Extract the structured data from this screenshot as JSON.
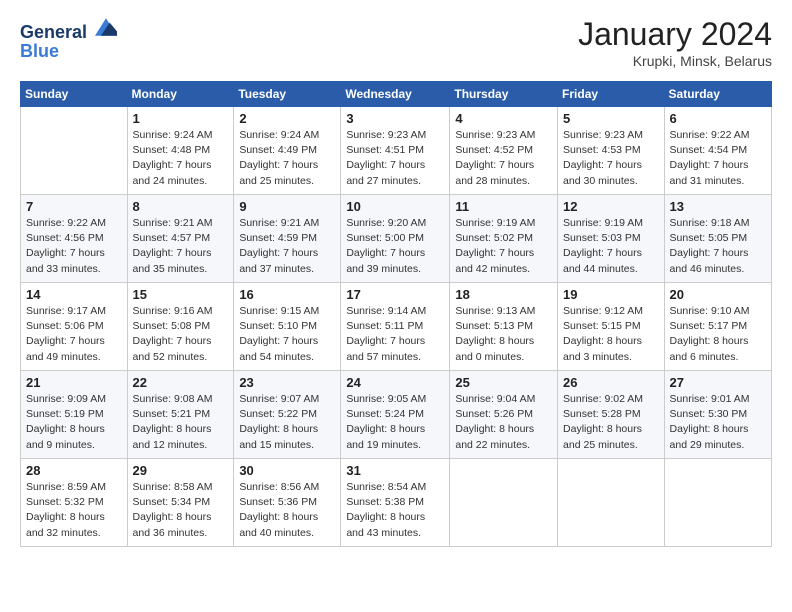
{
  "header": {
    "logo_line1": "General",
    "logo_line2": "Blue",
    "month_title": "January 2024",
    "location": "Krupki, Minsk, Belarus"
  },
  "calendar": {
    "weekdays": [
      "Sunday",
      "Monday",
      "Tuesday",
      "Wednesday",
      "Thursday",
      "Friday",
      "Saturday"
    ],
    "weeks": [
      [
        {
          "date": "",
          "info": ""
        },
        {
          "date": "1",
          "info": "Sunrise: 9:24 AM\nSunset: 4:48 PM\nDaylight: 7 hours\nand 24 minutes."
        },
        {
          "date": "2",
          "info": "Sunrise: 9:24 AM\nSunset: 4:49 PM\nDaylight: 7 hours\nand 25 minutes."
        },
        {
          "date": "3",
          "info": "Sunrise: 9:23 AM\nSunset: 4:51 PM\nDaylight: 7 hours\nand 27 minutes."
        },
        {
          "date": "4",
          "info": "Sunrise: 9:23 AM\nSunset: 4:52 PM\nDaylight: 7 hours\nand 28 minutes."
        },
        {
          "date": "5",
          "info": "Sunrise: 9:23 AM\nSunset: 4:53 PM\nDaylight: 7 hours\nand 30 minutes."
        },
        {
          "date": "6",
          "info": "Sunrise: 9:22 AM\nSunset: 4:54 PM\nDaylight: 7 hours\nand 31 minutes."
        }
      ],
      [
        {
          "date": "7",
          "info": "Sunrise: 9:22 AM\nSunset: 4:56 PM\nDaylight: 7 hours\nand 33 minutes."
        },
        {
          "date": "8",
          "info": "Sunrise: 9:21 AM\nSunset: 4:57 PM\nDaylight: 7 hours\nand 35 minutes."
        },
        {
          "date": "9",
          "info": "Sunrise: 9:21 AM\nSunset: 4:59 PM\nDaylight: 7 hours\nand 37 minutes."
        },
        {
          "date": "10",
          "info": "Sunrise: 9:20 AM\nSunset: 5:00 PM\nDaylight: 7 hours\nand 39 minutes."
        },
        {
          "date": "11",
          "info": "Sunrise: 9:19 AM\nSunset: 5:02 PM\nDaylight: 7 hours\nand 42 minutes."
        },
        {
          "date": "12",
          "info": "Sunrise: 9:19 AM\nSunset: 5:03 PM\nDaylight: 7 hours\nand 44 minutes."
        },
        {
          "date": "13",
          "info": "Sunrise: 9:18 AM\nSunset: 5:05 PM\nDaylight: 7 hours\nand 46 minutes."
        }
      ],
      [
        {
          "date": "14",
          "info": "Sunrise: 9:17 AM\nSunset: 5:06 PM\nDaylight: 7 hours\nand 49 minutes."
        },
        {
          "date": "15",
          "info": "Sunrise: 9:16 AM\nSunset: 5:08 PM\nDaylight: 7 hours\nand 52 minutes."
        },
        {
          "date": "16",
          "info": "Sunrise: 9:15 AM\nSunset: 5:10 PM\nDaylight: 7 hours\nand 54 minutes."
        },
        {
          "date": "17",
          "info": "Sunrise: 9:14 AM\nSunset: 5:11 PM\nDaylight: 7 hours\nand 57 minutes."
        },
        {
          "date": "18",
          "info": "Sunrise: 9:13 AM\nSunset: 5:13 PM\nDaylight: 8 hours\nand 0 minutes."
        },
        {
          "date": "19",
          "info": "Sunrise: 9:12 AM\nSunset: 5:15 PM\nDaylight: 8 hours\nand 3 minutes."
        },
        {
          "date": "20",
          "info": "Sunrise: 9:10 AM\nSunset: 5:17 PM\nDaylight: 8 hours\nand 6 minutes."
        }
      ],
      [
        {
          "date": "21",
          "info": "Sunrise: 9:09 AM\nSunset: 5:19 PM\nDaylight: 8 hours\nand 9 minutes."
        },
        {
          "date": "22",
          "info": "Sunrise: 9:08 AM\nSunset: 5:21 PM\nDaylight: 8 hours\nand 12 minutes."
        },
        {
          "date": "23",
          "info": "Sunrise: 9:07 AM\nSunset: 5:22 PM\nDaylight: 8 hours\nand 15 minutes."
        },
        {
          "date": "24",
          "info": "Sunrise: 9:05 AM\nSunset: 5:24 PM\nDaylight: 8 hours\nand 19 minutes."
        },
        {
          "date": "25",
          "info": "Sunrise: 9:04 AM\nSunset: 5:26 PM\nDaylight: 8 hours\nand 22 minutes."
        },
        {
          "date": "26",
          "info": "Sunrise: 9:02 AM\nSunset: 5:28 PM\nDaylight: 8 hours\nand 25 minutes."
        },
        {
          "date": "27",
          "info": "Sunrise: 9:01 AM\nSunset: 5:30 PM\nDaylight: 8 hours\nand 29 minutes."
        }
      ],
      [
        {
          "date": "28",
          "info": "Sunrise: 8:59 AM\nSunset: 5:32 PM\nDaylight: 8 hours\nand 32 minutes."
        },
        {
          "date": "29",
          "info": "Sunrise: 8:58 AM\nSunset: 5:34 PM\nDaylight: 8 hours\nand 36 minutes."
        },
        {
          "date": "30",
          "info": "Sunrise: 8:56 AM\nSunset: 5:36 PM\nDaylight: 8 hours\nand 40 minutes."
        },
        {
          "date": "31",
          "info": "Sunrise: 8:54 AM\nSunset: 5:38 PM\nDaylight: 8 hours\nand 43 minutes."
        },
        {
          "date": "",
          "info": ""
        },
        {
          "date": "",
          "info": ""
        },
        {
          "date": "",
          "info": ""
        }
      ]
    ]
  }
}
